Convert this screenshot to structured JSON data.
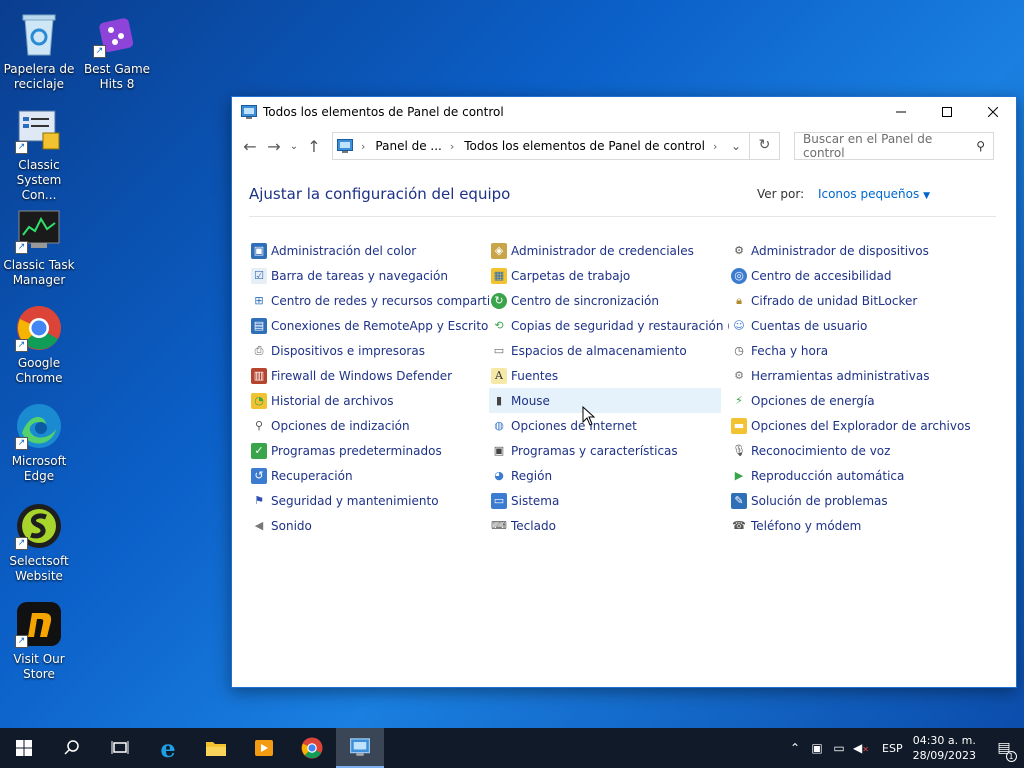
{
  "desktop": {
    "icons": [
      {
        "label": "Papelera de reciclaje",
        "icon": "recycle-bin-icon"
      },
      {
        "label": "Best Game Hits 8",
        "icon": "game-dice-icon"
      },
      {
        "label": "Classic System Con...",
        "icon": "system-config-icon"
      },
      {
        "label": "Classic Task Manager",
        "icon": "task-manager-icon"
      },
      {
        "label": "Google Chrome",
        "icon": "chrome-icon"
      },
      {
        "label": "Microsoft Edge",
        "icon": "edge-icon"
      },
      {
        "label": "Selectsoft Website",
        "icon": "selectsoft-icon"
      },
      {
        "label": "Visit Our Store",
        "icon": "store-icon"
      }
    ]
  },
  "window": {
    "title": "Todos los elementos de Panel de control",
    "breadcrumb": [
      "Panel de ...",
      "Todos los elementos de Panel de control"
    ],
    "search_placeholder": "Buscar en el Panel de control",
    "heading": "Ajustar la configuración del equipo",
    "view_by_label": "Ver por:",
    "view_by_value": "Iconos pequeños",
    "items": [
      [
        "Administración del color",
        "Administrador de credenciales",
        "Administrador de dispositivos"
      ],
      [
        "Barra de tareas y navegación",
        "Carpetas de trabajo",
        "Centro de accesibilidad"
      ],
      [
        "Centro de redes y recursos comparti...",
        "Centro de sincronización",
        "Cifrado de unidad BitLocker"
      ],
      [
        "Conexiones de RemoteApp y Escrito...",
        "Copias de seguridad y restauración (...",
        "Cuentas de usuario"
      ],
      [
        "Dispositivos e impresoras",
        "Espacios de almacenamiento",
        "Fecha y hora"
      ],
      [
        "Firewall de Windows Defender",
        "Fuentes",
        "Herramientas administrativas"
      ],
      [
        "Historial de archivos",
        "Mouse",
        "Opciones de energía"
      ],
      [
        "Opciones de indización",
        "Opciones de Internet",
        "Opciones del Explorador de archivos"
      ],
      [
        "Programas predeterminados",
        "Programas y características",
        "Reconocimiento de voz"
      ],
      [
        "Recuperación",
        "Región",
        "Reproducción automática"
      ],
      [
        "Seguridad y mantenimiento",
        "Sistema",
        "Solución de problemas"
      ],
      [
        "Sonido",
        "Teclado",
        "Teléfono y módem"
      ]
    ]
  },
  "taskbar": {
    "language": "ESP",
    "time": "04:30 a. m.",
    "date": "28/09/2023",
    "notification_count": "1"
  }
}
